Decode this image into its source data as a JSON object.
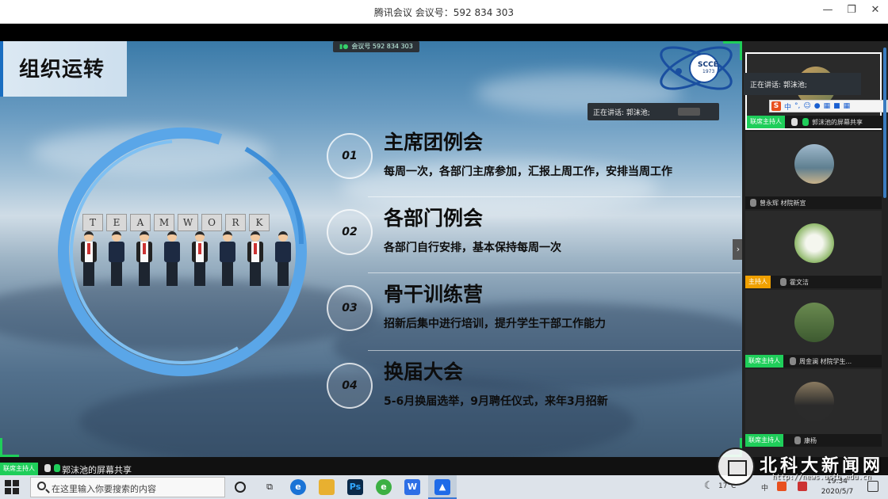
{
  "window": {
    "title": "腾讯会议 会议号：592 834 303",
    "controls": [
      "minimize-icon",
      "restore-icon",
      "close-icon"
    ]
  },
  "slide": {
    "title": "组织运转",
    "meeting_chip": "会议号 592 834 303",
    "speaking_chip": "正在讲话: 郭沫池;",
    "logo": {
      "text": "SCCE",
      "year": "1973"
    },
    "teamwork_letters": [
      "T",
      "E",
      "A",
      "M",
      "W",
      "O",
      "R",
      "K"
    ],
    "items": [
      {
        "num": "01",
        "head": "主席团例会",
        "desc": "每周一次，各部门主席参加，汇报上周工作，安排当周工作"
      },
      {
        "num": "02",
        "head": "各部门例会",
        "desc": "各部门自行安排，基本保持每周一次"
      },
      {
        "num": "03",
        "head": "骨干训练营",
        "desc": "招新后集中进行培训，提升学生干部工作能力"
      },
      {
        "num": "04",
        "head": "换届大会",
        "desc": "5-6月换届选举，9月聘任仪式，来年3月招新"
      }
    ]
  },
  "panel": {
    "speaking_chip": "正在讲话: 郭沫池;",
    "ime": {
      "logo": "S",
      "mode": "中",
      "punct": "°,"
    },
    "participants": [
      {
        "role": "联席主持人",
        "name": "郭沫池的屏幕共享",
        "role_color": "green",
        "active": true
      },
      {
        "role": "",
        "name": "曾永辉 材院新宣",
        "role_color": "",
        "active": false
      },
      {
        "role": "主持人",
        "name": "霍文洁",
        "role_color": "orange",
        "active": false
      },
      {
        "role": "联席主持人",
        "name": "周金澜 材院学生...",
        "role_color": "green",
        "active": false
      },
      {
        "role": "联席主持人",
        "name": "康杨",
        "role_color": "green",
        "active": false
      }
    ]
  },
  "sharebar": {
    "role": "联席主持人",
    "text": "郭沫池的屏幕共享"
  },
  "taskbar": {
    "search_placeholder": "在这里输入你要搜索的内容",
    "apps": [
      "task-view-icon",
      "edge-icon",
      "file-explorer-icon",
      "photoshop-icon",
      "360-browser-icon",
      "wps-icon",
      "tencent-meeting-icon"
    ],
    "ps_label": "Ps",
    "wps_label": "W",
    "tray_temp": "17°C",
    "tray_ime": "中",
    "time": "19:34",
    "date": "2020/5/7"
  },
  "watermark": {
    "name": "北科大新闻网",
    "url": "http://news.ustb.edu.cn"
  }
}
